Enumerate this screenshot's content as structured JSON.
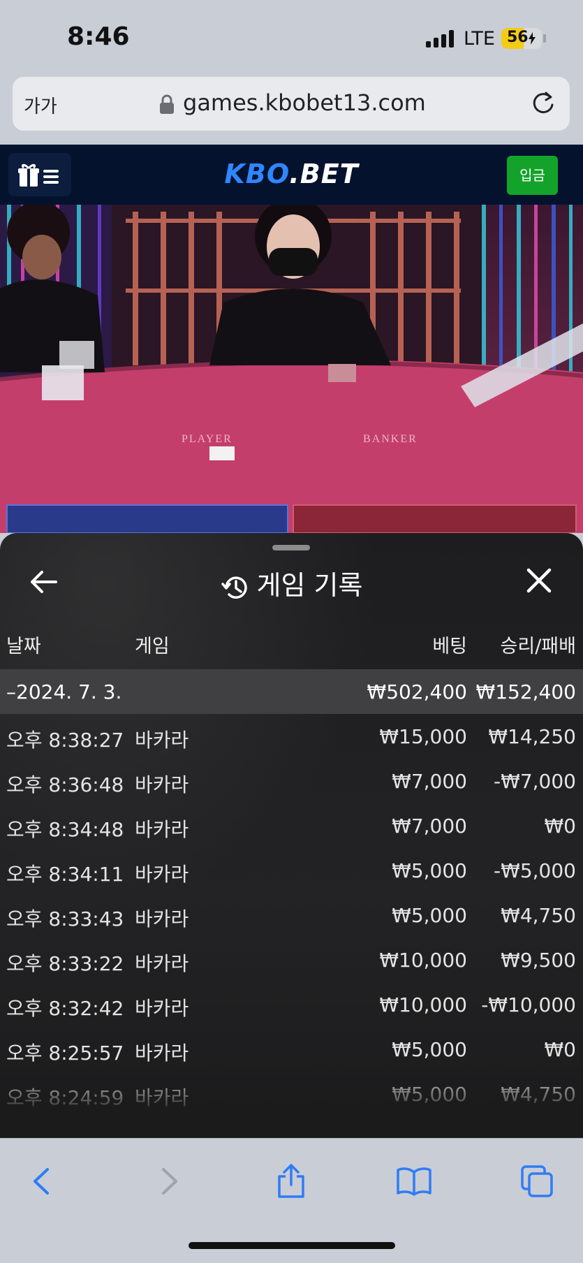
{
  "status_bar": {
    "time": "8:46",
    "network": "LTE",
    "battery": "56",
    "battery_level_percent": 56
  },
  "browser": {
    "text_size_label": "가가",
    "url": "games.kbobet13.com"
  },
  "site": {
    "logo_left": "KBO",
    "logo_right": ".BET",
    "deposit_label": "입금",
    "brand_color": "#2f86ff",
    "deposit_color": "#13a32a"
  },
  "video": {
    "table_left_label": "PLAYER",
    "table_right_label": "BANKER"
  },
  "history": {
    "title": "게임 기록",
    "columns": {
      "date": "날짜",
      "game": "게임",
      "bet": "베팅",
      "win_loss": "승리/패배"
    },
    "summary": {
      "date": "–2024. 7. 3.",
      "bet": "₩502,400",
      "win_loss": "₩152,400"
    },
    "rows": [
      {
        "time": "오후 8:38:27",
        "game": "바카라",
        "bet": "₩15,000",
        "win_loss": "₩14,250"
      },
      {
        "time": "오후 8:36:48",
        "game": "바카라",
        "bet": "₩7,000",
        "win_loss": "-₩7,000"
      },
      {
        "time": "오후 8:34:48",
        "game": "바카라",
        "bet": "₩7,000",
        "win_loss": "₩0"
      },
      {
        "time": "오후 8:34:11",
        "game": "바카라",
        "bet": "₩5,000",
        "win_loss": "-₩5,000"
      },
      {
        "time": "오후 8:33:43",
        "game": "바카라",
        "bet": "₩5,000",
        "win_loss": "₩4,750"
      },
      {
        "time": "오후 8:33:22",
        "game": "바카라",
        "bet": "₩10,000",
        "win_loss": "₩9,500"
      },
      {
        "time": "오후 8:32:42",
        "game": "바카라",
        "bet": "₩10,000",
        "win_loss": "-₩10,000"
      },
      {
        "time": "오후 8:25:57",
        "game": "바카라",
        "bet": "₩5,000",
        "win_loss": "₩0"
      },
      {
        "time": "오후 8:24:59",
        "game": "바카라",
        "bet": "₩5,000",
        "win_loss": "₩4,750"
      }
    ]
  },
  "toolbar": {
    "icons": [
      "back-icon",
      "forward-icon",
      "share-icon",
      "bookmarks-icon",
      "tabs-icon"
    ]
  }
}
